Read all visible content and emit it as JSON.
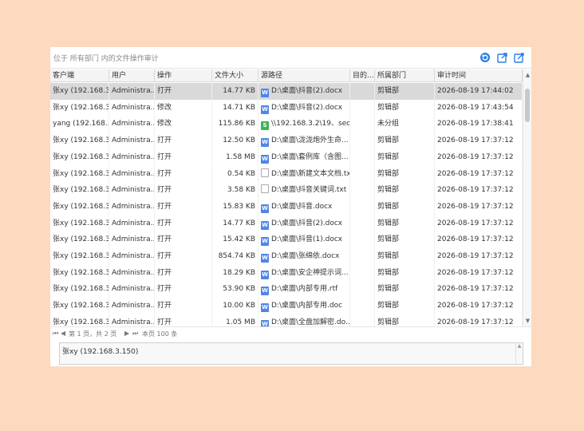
{
  "breadcrumb": "位于 所有部门 内的文件操作审计",
  "toolbar": {
    "refresh_icon": "refresh-icon",
    "export_icon": "export-icon",
    "export_all_icon": "export-all-icon"
  },
  "columns": [
    "客户端",
    "用户",
    "操作",
    "文件大小",
    "源路径",
    "目的...",
    "所属部门",
    "审计时间"
  ],
  "rows": [
    {
      "client": "张xy (192.168.3...",
      "user": "Administra...",
      "op": "打开",
      "size": "14.77 KB",
      "icon": "W",
      "path": "D:\\桌面\\抖音(2).docx",
      "dest": "",
      "dept": "剪辑部",
      "time": "2026-08-19 17:44:02",
      "selected": true
    },
    {
      "client": "张xy (192.168.3...",
      "user": "Administra...",
      "op": "修改",
      "size": "14.71 KB",
      "icon": "W",
      "path": "D:\\桌面\\抖音(2).docx",
      "dest": "",
      "dept": "剪辑部",
      "time": "2026-08-19 17:43:54"
    },
    {
      "client": "yang (192.168....",
      "user": "Administra...",
      "op": "修改",
      "size": "115.86 KB",
      "icon": "S",
      "path": "\\\\192.168.3.2\\19、seo...",
      "dest": "",
      "dept": "未分组",
      "time": "2026-08-19 17:38:41"
    },
    {
      "client": "张xy (192.168.3...",
      "user": "Administra...",
      "op": "打开",
      "size": "12.50 KB",
      "icon": "W",
      "path": "D:\\桌面\\泷泷炮外生命...",
      "dest": "",
      "dept": "剪辑部",
      "time": "2026-08-19 17:37:12"
    },
    {
      "client": "张xy (192.168.3...",
      "user": "Administra...",
      "op": "打开",
      "size": "1.58 MB",
      "icon": "W",
      "path": "D:\\桌面\\套例库（含图...",
      "dest": "",
      "dept": "剪辑部",
      "time": "2026-08-19 17:37:12"
    },
    {
      "client": "张xy (192.168.3...",
      "user": "Administra...",
      "op": "打开",
      "size": "0.54 KB",
      "icon": "T",
      "path": "D:\\桌面\\新建文本文档.txt",
      "dest": "",
      "dept": "剪辑部",
      "time": "2026-08-19 17:37:12"
    },
    {
      "client": "张xy (192.168.3...",
      "user": "Administra...",
      "op": "打开",
      "size": "3.58 KB",
      "icon": "T",
      "path": "D:\\桌面\\抖音关键词.txt",
      "dest": "",
      "dept": "剪辑部",
      "time": "2026-08-19 17:37:12"
    },
    {
      "client": "张xy (192.168.3...",
      "user": "Administra...",
      "op": "打开",
      "size": "15.83 KB",
      "icon": "W",
      "path": "D:\\桌面\\抖音.docx",
      "dest": "",
      "dept": "剪辑部",
      "time": "2026-08-19 17:37:12"
    },
    {
      "client": "张xy (192.168.3...",
      "user": "Administra...",
      "op": "打开",
      "size": "14.77 KB",
      "icon": "W",
      "path": "D:\\桌面\\抖音(2).docx",
      "dest": "",
      "dept": "剪辑部",
      "time": "2026-08-19 17:37:12"
    },
    {
      "client": "张xy (192.168.3...",
      "user": "Administra...",
      "op": "打开",
      "size": "15.42 KB",
      "icon": "W",
      "path": "D:\\桌面\\抖音(1).docx",
      "dest": "",
      "dept": "剪辑部",
      "time": "2026-08-19 17:37:12"
    },
    {
      "client": "张xy (192.168.3...",
      "user": "Administra...",
      "op": "打开",
      "size": "854.74 KB",
      "icon": "W",
      "path": "D:\\桌面\\张绵依.docx",
      "dest": "",
      "dept": "剪辑部",
      "time": "2026-08-19 17:37:12"
    },
    {
      "client": "张xy (192.168.3...",
      "user": "Administra...",
      "op": "打开",
      "size": "18.29 KB",
      "icon": "W",
      "path": "D:\\桌面\\安企神提示词...",
      "dest": "",
      "dept": "剪辑部",
      "time": "2026-08-19 17:37:12"
    },
    {
      "client": "张xy (192.168.3...",
      "user": "Administra...",
      "op": "打开",
      "size": "53.90 KB",
      "icon": "W",
      "path": "D:\\桌面\\内部专用.rtf",
      "dest": "",
      "dept": "剪辑部",
      "time": "2026-08-19 17:37:12"
    },
    {
      "client": "张xy (192.168.3...",
      "user": "Administra...",
      "op": "打开",
      "size": "10.00 KB",
      "icon": "W",
      "path": "D:\\桌面\\内部专用.doc",
      "dest": "",
      "dept": "剪辑部",
      "time": "2026-08-19 17:37:12"
    },
    {
      "client": "张xy (192.168.3...",
      "user": "Administra...",
      "op": "打开",
      "size": "1.05 MB",
      "icon": "W",
      "path": "D:\\桌面\\全盘加解密.do...",
      "dest": "",
      "dept": "剪辑部",
      "time": "2026-08-19 17:37:12"
    }
  ],
  "pager": {
    "first": "⏮",
    "prev": "◀",
    "page_text": "第 1 页，共 2 页",
    "next": "▶",
    "last": "⏭",
    "count_text": "本页 100 条"
  },
  "detail": {
    "text": "张xy (192.168.3.150)"
  }
}
